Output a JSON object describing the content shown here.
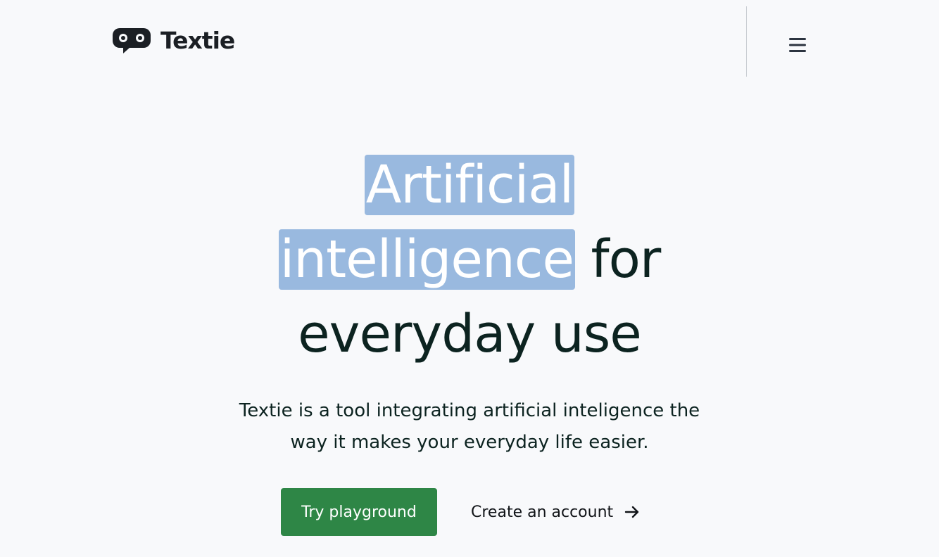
{
  "brand": {
    "name": "Textie",
    "logo_icon": "speech-bubble-eyes-icon"
  },
  "header": {
    "menu_icon": "hamburger-menu-icon"
  },
  "hero": {
    "headline_highlight": "Artificial intelligence",
    "headline_rest": "for everyday use",
    "subtitle": "Textie is a tool integrating artificial inteligence the way it makes your everyday life easier."
  },
  "actions": {
    "primary_label": "Try playground",
    "secondary_label": "Create an account",
    "secondary_icon": "arrow-right-icon"
  },
  "colors": {
    "background": "#f8f9fb",
    "text": "#0c2320",
    "highlight": "#99b9df",
    "primary_button": "#2e8646"
  }
}
